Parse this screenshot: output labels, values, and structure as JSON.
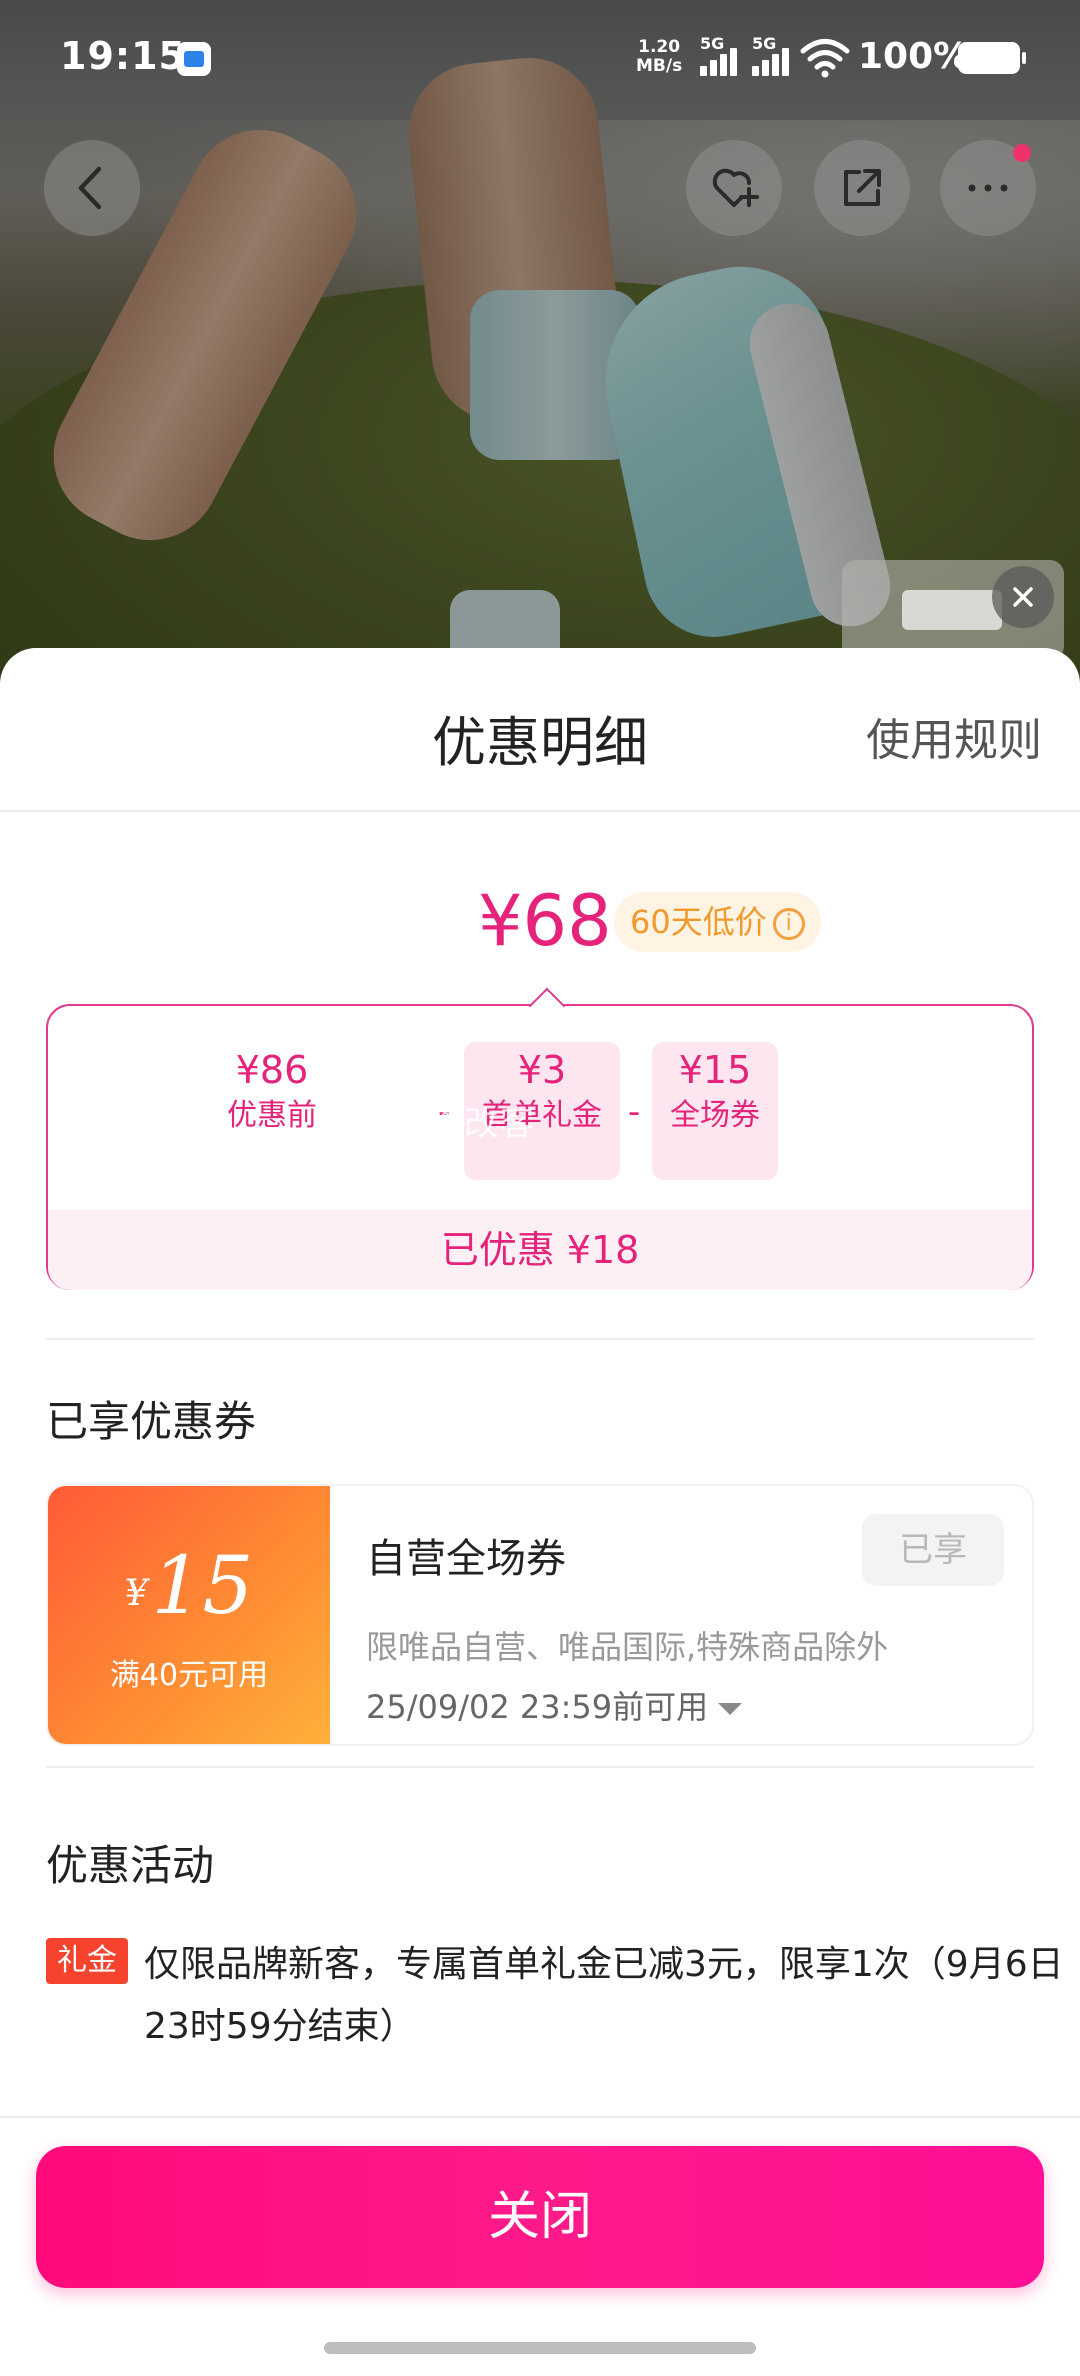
{
  "status_bar": {
    "time": "19:15",
    "net_speed_value": "1.20",
    "net_speed_unit": "MB/s",
    "sim1": "5G",
    "sim2": "5G",
    "battery": "100%"
  },
  "sheet": {
    "title": "优惠明细",
    "rules_link": "使用规则"
  },
  "price": {
    "final": "¥68",
    "tag": "60天低价",
    "tag_icon": "i"
  },
  "breakdown": {
    "items": [
      {
        "value": "¥86",
        "label": "优惠前"
      },
      {
        "value": "¥3",
        "label": "首单礼金"
      },
      {
        "value": "¥15",
        "label": "全场券"
      }
    ],
    "operator": "-",
    "watermark": "修改客",
    "total": "已优惠 ¥18"
  },
  "coupons_section": {
    "title": "已享优惠券",
    "coupon": {
      "currency": "¥",
      "amount": "15",
      "condition": "满40元可用",
      "name": "自营全场券",
      "status": "已享",
      "description": "限唯品自营、唯品国际,特殊商品除外",
      "validity": "25/09/02 23:59前可用"
    }
  },
  "activity_section": {
    "title": "优惠活动",
    "tag": "礼金",
    "text": "仅限品牌新客，专属首单礼金已减3元，限享1次（9月6日23时59分结束）"
  },
  "footer": {
    "close_label": "关闭"
  },
  "colors": {
    "accent_pink": "#e5237a",
    "button_pink": "#ff0a7a",
    "coupon_orange": "#ff8a33"
  }
}
